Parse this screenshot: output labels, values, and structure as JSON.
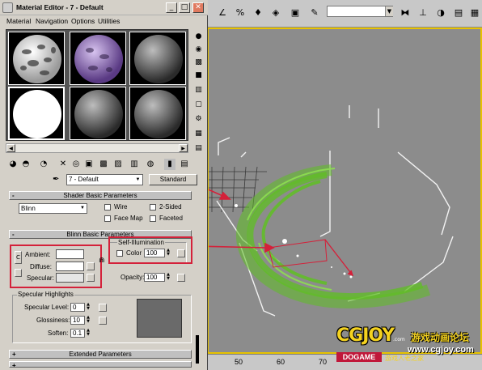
{
  "editor": {
    "title": "Material Editor - 7 - Default",
    "menu": [
      "Material",
      "Navigation",
      "Options",
      "Utilities"
    ],
    "material_name": "7 - Default",
    "material_type": "Standard"
  },
  "shader_basic": {
    "header": "Shader Basic Parameters",
    "shader": "Blinn",
    "wire": "Wire",
    "two_sided": "2-Sided",
    "face_map": "Face Map",
    "faceted": "Faceted"
  },
  "blinn_basic": {
    "header": "Blinn Basic Parameters",
    "ambient": "Ambient:",
    "diffuse": "Diffuse:",
    "specular": "Specular:",
    "lock": "C",
    "self_illum": {
      "group": "Self-Illumination",
      "color_label": "Color",
      "value": "100"
    },
    "opacity_label": "Opacity:",
    "opacity_value": "100"
  },
  "specular_highlights": {
    "group": "Specular Highlights",
    "level_label": "Specular Level:",
    "level_value": "0",
    "gloss_label": "Glossiness:",
    "gloss_value": "10",
    "soften_label": "Soften:",
    "soften_value": "0.1"
  },
  "extended": {
    "header": "Extended Parameters"
  },
  "ruler": [
    "50",
    "60",
    "70"
  ],
  "watermark": {
    "logo": "CGJOY",
    "com": ".com",
    "cn_title": "游戏动画论坛",
    "url": "www.cgjoy.com",
    "dogame": "DOGAME",
    "cn_sub": "游戏人老之家"
  },
  "colors": {
    "particles": "#5fbf23",
    "annotation_red": "#d4213a",
    "viewport_border": "#e8c300"
  }
}
